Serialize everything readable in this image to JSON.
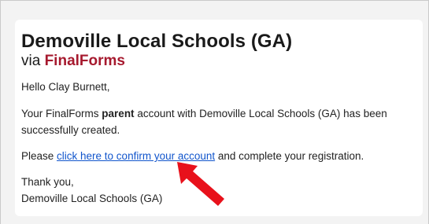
{
  "email": {
    "heading": "Demoville Local Schools (GA)",
    "via_prefix": "via",
    "brand": "FinalForms",
    "greeting": "Hello Clay Burnett,",
    "intro_before": "Your FinalForms ",
    "intro_bold": "parent",
    "intro_after": " account with Demoville Local Schools (GA) has been successfully created.",
    "confirm_before": "Please ",
    "confirm_link": "click here to confirm your account",
    "confirm_after": " and complete your registration.",
    "signoff": "Thank you,",
    "signature": "Demoville Local Schools (GA)"
  },
  "colors": {
    "brand": "#a6192e",
    "link": "#1155cc",
    "arrow": "#e8111b"
  },
  "icons": {
    "pointer": "red-arrow-icon"
  }
}
